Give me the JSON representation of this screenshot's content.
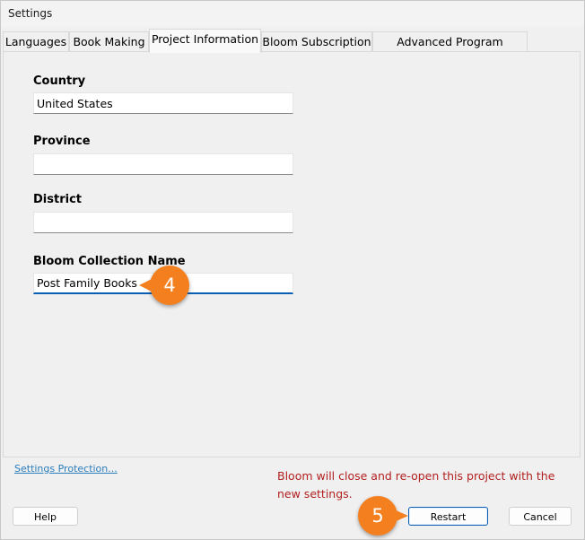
{
  "window": {
    "title": "Settings"
  },
  "tabs": [
    {
      "label": "Languages"
    },
    {
      "label": "Book Making"
    },
    {
      "label": "Project Information",
      "active": true
    },
    {
      "label": "Bloom Subscription"
    },
    {
      "label": "Advanced Program Settings"
    }
  ],
  "fields": {
    "country": {
      "label": "Country",
      "value": "United States"
    },
    "province": {
      "label": "Province",
      "value": ""
    },
    "district": {
      "label": "District",
      "value": ""
    },
    "collection": {
      "label": "Bloom Collection Name",
      "value": "Post Family Books"
    }
  },
  "footer": {
    "settings_protection": "Settings Protection...",
    "notice": "Bloom will close and re-open this project with the new settings.",
    "help": "Help",
    "restart": "Restart",
    "cancel": "Cancel"
  },
  "callouts": {
    "first": "4",
    "second": "5"
  },
  "colors": {
    "callout": "#f47f1f",
    "notice": "#b22020",
    "link": "#2a7dbc",
    "focus": "#0a5fb4"
  }
}
